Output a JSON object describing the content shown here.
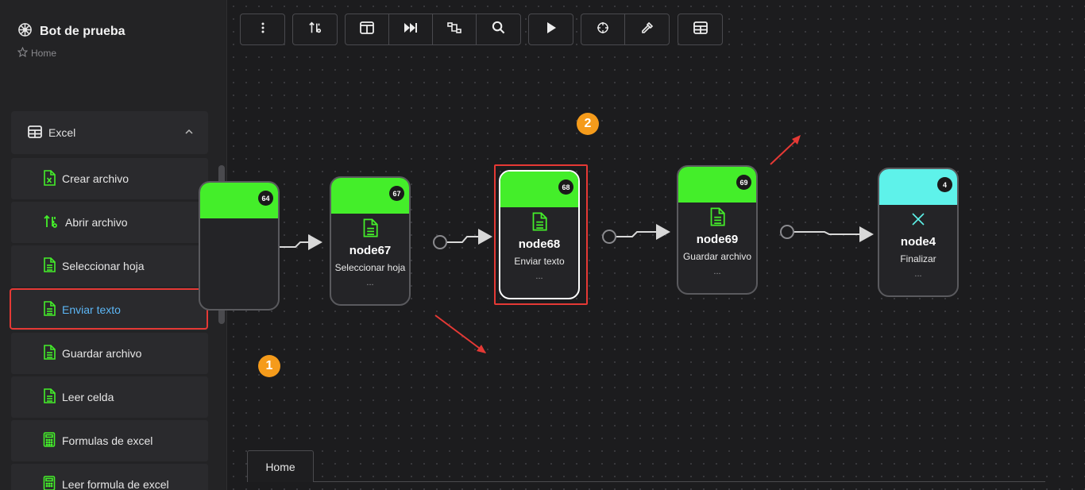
{
  "app": {
    "title": "Bot de prueba",
    "breadcrumb": "Home"
  },
  "sidebar": {
    "group": {
      "label": "Excel",
      "expanded": true
    },
    "items": [
      {
        "label": "Crear archivo",
        "icon": "excel-file-icon"
      },
      {
        "label": "Abrir archivo",
        "icon": "sort-arrows-icon"
      },
      {
        "label": "Seleccionar hoja",
        "icon": "document-icon"
      },
      {
        "label": "Enviar texto",
        "icon": "document-icon",
        "active": true
      },
      {
        "label": "Guardar archivo",
        "icon": "document-icon"
      },
      {
        "label": "Leer celda",
        "icon": "document-icon"
      },
      {
        "label": "Formulas de excel",
        "icon": "calculator-icon"
      },
      {
        "label": "Leer formula de excel",
        "icon": "calculator-icon"
      }
    ]
  },
  "toolbar": {
    "buttons": [
      "more-vertical-icon",
      "sort-icon",
      "columns-icon",
      "skip-forward-icon",
      "flow-icon",
      "search-icon",
      "play-icon",
      "crosshair-icon",
      "eyedropper-icon",
      "table-icon"
    ]
  },
  "nodes": [
    {
      "id": "64",
      "name": "",
      "subtitle": "",
      "color": "#44ee2a"
    },
    {
      "id": "67",
      "name": "node67",
      "subtitle": "Seleccionar hoja",
      "dots": "...",
      "color": "#44ee2a"
    },
    {
      "id": "68",
      "name": "node68",
      "subtitle": "Enviar texto",
      "dots": "...",
      "color": "#44ee2a",
      "selected": true
    },
    {
      "id": "69",
      "name": "node69",
      "subtitle": "Guardar archivo",
      "dots": "...",
      "color": "#44ee2a"
    },
    {
      "id": "4",
      "name": "node4",
      "subtitle": "Finalizar",
      "dots": "...",
      "color": "#5ef2ea"
    }
  ],
  "annotations": {
    "marker1": "1",
    "marker2": "2"
  },
  "tabs": [
    {
      "label": "Home"
    }
  ],
  "colors": {
    "accent_green": "#44ee2a",
    "accent_cyan": "#5ef2ea",
    "highlight_red": "#e53935",
    "marker_orange": "#f59b1b",
    "active_text": "#5cb6f5"
  }
}
